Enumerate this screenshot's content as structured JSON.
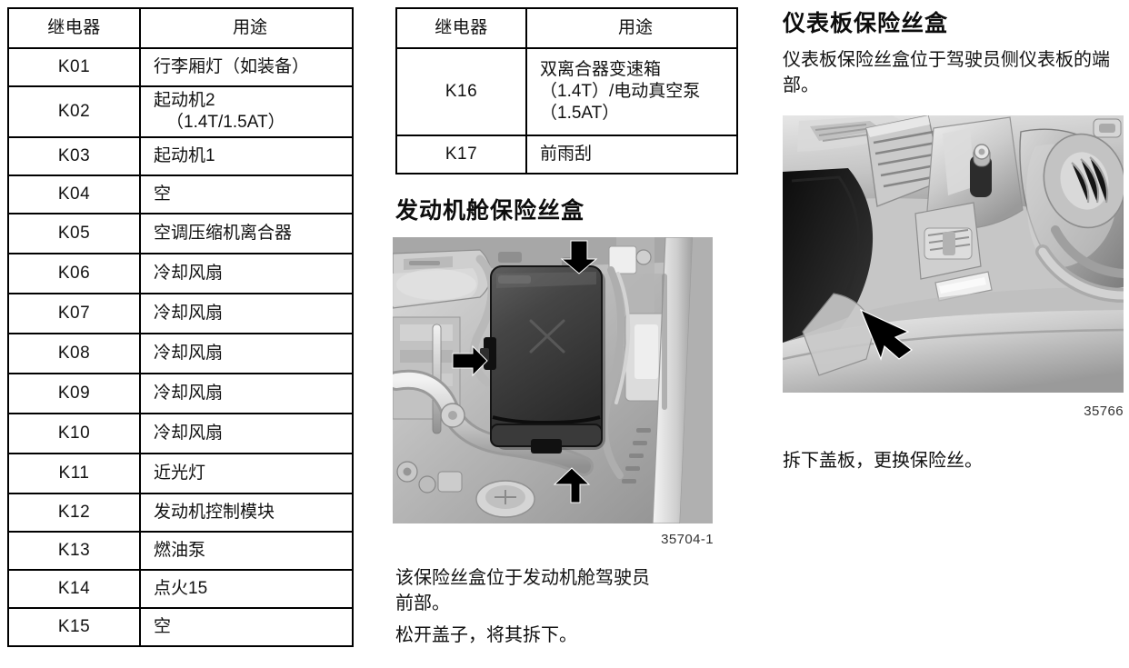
{
  "page": {
    "background": "#ffffff",
    "text_color": "#111111"
  },
  "relay_table_left": {
    "headers": [
      "继电器",
      "用途"
    ],
    "rows": [
      {
        "id": "K01",
        "use": "行李厢灯（如装备）",
        "use_sub": ""
      },
      {
        "id": "K02",
        "use": "起动机2",
        "use_sub": "（1.4T/1.5AT）"
      },
      {
        "id": "K03",
        "use": "起动机1",
        "use_sub": ""
      },
      {
        "id": "K04",
        "use": "空",
        "use_sub": ""
      },
      {
        "id": "K05",
        "use": "空调压缩机离合器",
        "use_sub": ""
      },
      {
        "id": "K06",
        "use": "冷却风扇",
        "use_sub": ""
      },
      {
        "id": "K07",
        "use": "冷却风扇",
        "use_sub": ""
      },
      {
        "id": "K08",
        "use": "冷却风扇",
        "use_sub": ""
      },
      {
        "id": "K09",
        "use": "冷却风扇",
        "use_sub": ""
      },
      {
        "id": "K10",
        "use": "冷却风扇",
        "use_sub": ""
      },
      {
        "id": "K11",
        "use": "近光灯",
        "use_sub": ""
      },
      {
        "id": "K12",
        "use": "发动机控制模块",
        "use_sub": ""
      },
      {
        "id": "K13",
        "use": "燃油泵",
        "use_sub": ""
      },
      {
        "id": "K14",
        "use": "点火15",
        "use_sub": ""
      },
      {
        "id": "K15",
        "use": "空",
        "use_sub": ""
      }
    ]
  },
  "relay_table_mid": {
    "headers": [
      "继电器",
      "用途"
    ],
    "rows": [
      {
        "id": "K16",
        "use": "双离合器变速箱（1.4T）/电动真空泵（1.5AT）",
        "use_sub": ""
      },
      {
        "id": "K17",
        "use": "前雨刮",
        "use_sub": ""
      }
    ]
  },
  "engine_section": {
    "heading": "发动机舱保险丝盒",
    "figure_caption": "35704-1",
    "body_line_1": "该保险丝盒位于发动机舱驾驶员前部。",
    "body_line_2": "松开盖子，将其拆下。"
  },
  "dash_section": {
    "heading": "仪表板保险丝盒",
    "intro": "仪表板保险丝盒位于驾驶员侧仪表板的端部。",
    "figure_caption": "35766",
    "body_line_1": "拆下盖板，更换保险丝。"
  }
}
